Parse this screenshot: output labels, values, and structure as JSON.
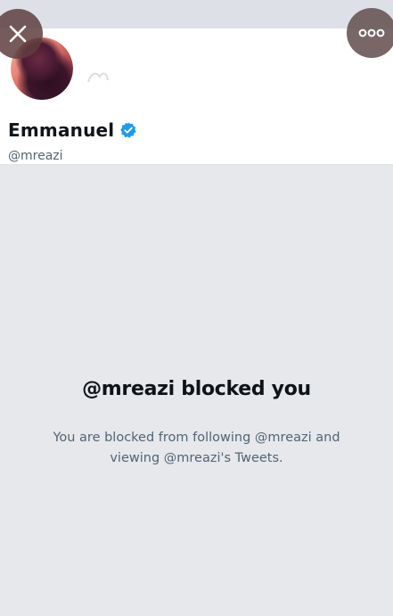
{
  "profile": {
    "display_name": "Emmanuel",
    "handle": "@mreazi",
    "verified": true
  },
  "blocked": {
    "title": "@mreazi blocked you",
    "description": "You are blocked from following @mreazi and viewing @mreazi's Tweets."
  },
  "icons": {
    "close": "close-icon",
    "more": "more-horizontal-icon",
    "verified": "verified-badge-icon"
  },
  "colors": {
    "verified_blue": "#1d9bf0",
    "text_primary": "#0f1419",
    "text_secondary": "#536471",
    "background_gray": "#e6e8ec"
  }
}
